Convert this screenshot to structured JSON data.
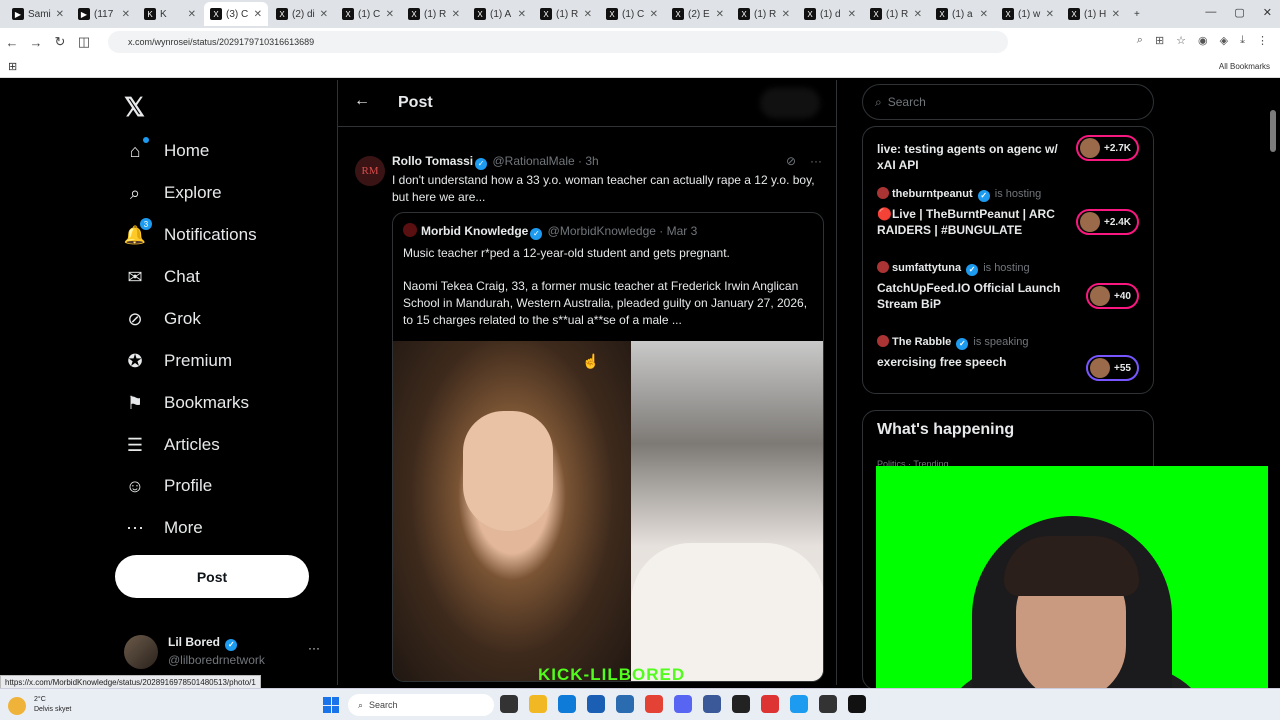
{
  "browser": {
    "tabs": [
      {
        "label": "Sami",
        "icon": "▶"
      },
      {
        "label": "(117",
        "icon": "▶"
      },
      {
        "label": "K",
        "icon": "K"
      },
      {
        "label": "(3) C",
        "icon": "X"
      },
      {
        "label": "(2) di",
        "icon": "X"
      },
      {
        "label": "(1) C",
        "icon": "X"
      },
      {
        "label": "(1) R",
        "icon": "X"
      },
      {
        "label": "(1) A",
        "icon": "X"
      },
      {
        "label": "(1) R",
        "icon": "X"
      },
      {
        "label": "(1) C",
        "icon": "X"
      },
      {
        "label": "(2) E",
        "icon": "X"
      },
      {
        "label": "(1) R",
        "icon": "X"
      },
      {
        "label": "(1) d",
        "icon": "X"
      },
      {
        "label": "(1) R",
        "icon": "X"
      },
      {
        "label": "(1) a",
        "icon": "X"
      },
      {
        "label": "(1) w",
        "icon": "X"
      },
      {
        "label": "(1) H",
        "icon": "X"
      }
    ],
    "url": "x.com/wynrosei/status/2029179710316613689",
    "all_bookmarks": "All Bookmarks",
    "status_url": "https://x.com/MorbidKnowledge/status/2028916978501480513/photo/1"
  },
  "nav": {
    "items": [
      {
        "label": "Home",
        "icon": "⌂",
        "name": "home"
      },
      {
        "label": "Explore",
        "icon": "⌕",
        "name": "explore"
      },
      {
        "label": "Notifications",
        "icon": "🔔",
        "name": "notifications",
        "badge": "3"
      },
      {
        "label": "Chat",
        "icon": "✉",
        "name": "chat"
      },
      {
        "label": "Grok",
        "icon": "⊘",
        "name": "grok"
      },
      {
        "label": "Premium",
        "icon": "✪",
        "name": "premium"
      },
      {
        "label": "Bookmarks",
        "icon": "⚑",
        "name": "bookmarks"
      },
      {
        "label": "Articles",
        "icon": "☰",
        "name": "articles"
      },
      {
        "label": "Profile",
        "icon": "☺",
        "name": "profile"
      },
      {
        "label": "More",
        "icon": "⋯",
        "name": "more"
      }
    ],
    "post_button": "Post",
    "user": {
      "name": "Lil Bored",
      "handle": "@lilboredrnetwork"
    }
  },
  "main": {
    "title": "Post",
    "tweet": {
      "avatar_text": "RM",
      "name": "Rollo Tomassi",
      "handle": "@RationalMale",
      "time": "· 3h",
      "text": "I don't understand how a 33 y.o. woman teacher can actually rape a 12 y.o. boy, but here we are...",
      "quote": {
        "name": "Morbid Knowledge",
        "handle": "@MorbidKnowledge",
        "time": "· Mar 3",
        "line1": "Music teacher r*ped a 12-year-old student and gets pregnant.",
        "line2": "Naomi Tekea Craig, 33, a former music teacher at Frederick Irwin Anglican School in Mandurah, Western Australia, pleaded guilty on January 27, 2026, to 15 charges related to the s**ual a**se of a male ..."
      }
    },
    "overlay_text": "KICK-LILBORED"
  },
  "right": {
    "search_placeholder": "Search",
    "spaces": [
      {
        "host": "",
        "hosting": "",
        "title": "live: testing agents on agenc w/ xAI API",
        "count": "+2.7K",
        "pill": "pink"
      },
      {
        "host": "theburntpeanut",
        "hosting": "is hosting",
        "title": "🔴Live | TheBurntPeanut | ARC RAIDERS | #BUNGULATE",
        "count": "+2.4K",
        "pill": "pink"
      },
      {
        "host": "sumfattytuna",
        "hosting": "is hosting",
        "title": "CatchUpFeed.IO Official Launch Stream BiP",
        "count": "+40",
        "pill": "pink"
      },
      {
        "host": "The Rabble",
        "hosting": "is speaking",
        "title": "exercising free speech",
        "count": "+55",
        "pill": "purple"
      }
    ],
    "whats_happening": "What's happening",
    "trend_sub": "Politics · Trending"
  },
  "taskbar": {
    "temp": "2°C",
    "weather": "Delvis skyet",
    "search": "Search"
  },
  "colors": {
    "accent": "#1d9bf0",
    "live_pink": "#f91880",
    "kick_green": "#52fc1c",
    "greenscreen": "#00ff00"
  }
}
